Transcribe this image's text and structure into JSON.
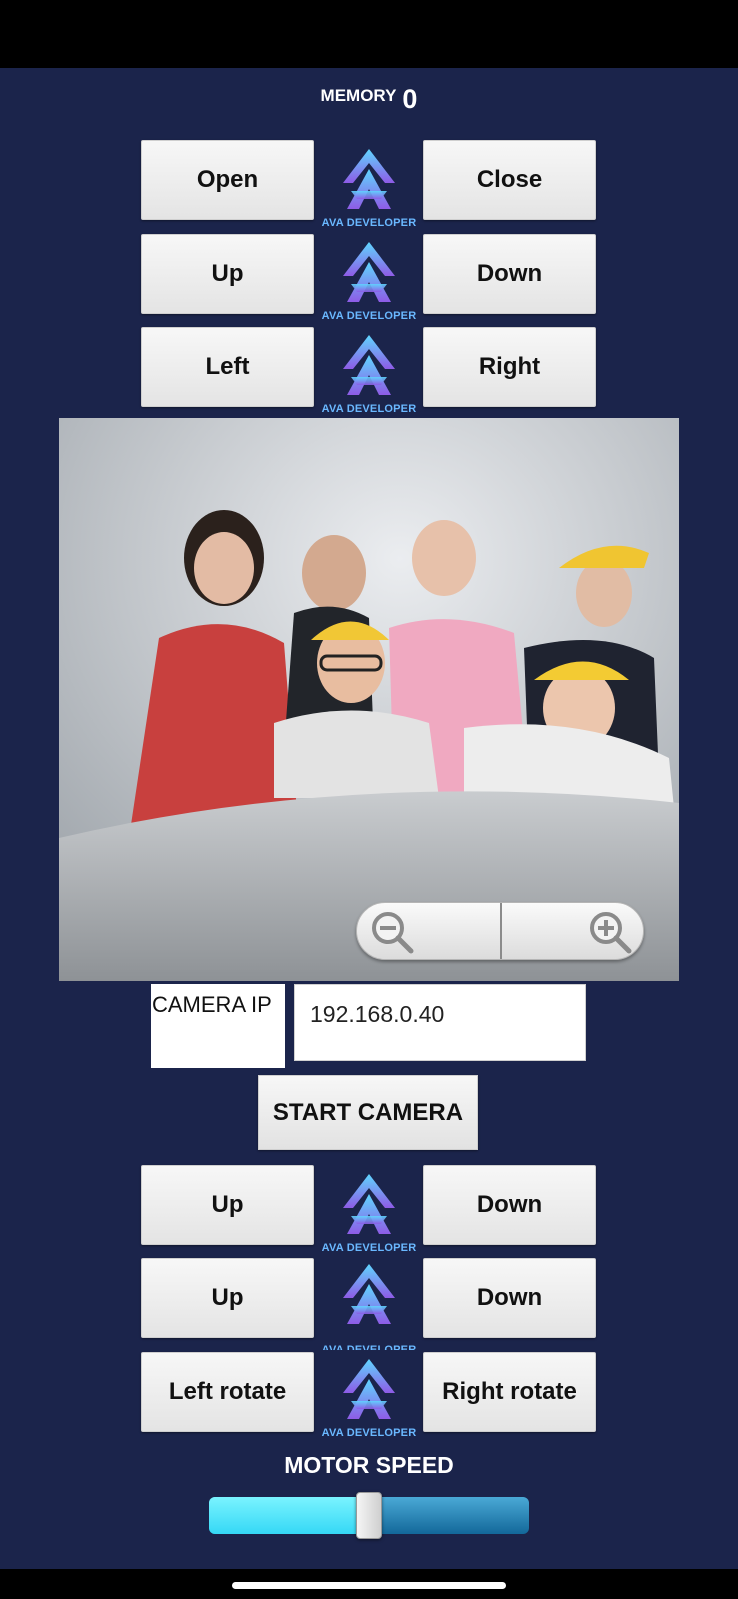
{
  "memory": {
    "label": "MEMORY",
    "value": "0"
  },
  "logo_text": "AVA DEVELOPER",
  "top_controls": [
    {
      "left": "Open",
      "right": "Close"
    },
    {
      "left": "Up",
      "right": "Down"
    },
    {
      "left": "Left",
      "right": "Right"
    }
  ],
  "camera": {
    "ip_label": "CAMERA IP",
    "ip_value": "192.168.0.40",
    "start_label": "START CAMERA"
  },
  "bottom_controls": [
    {
      "left": "Up",
      "right": "Down"
    },
    {
      "left": "Up",
      "right": "Down"
    },
    {
      "left": "Left rotate",
      "right": "Right rotate"
    }
  ],
  "motor_speed": {
    "label": "MOTOR SPEED",
    "value_fraction": 0.5
  },
  "colors": {
    "background": "#1b244b",
    "slider_fill": "#35d8f5",
    "logo_text": "#6ab8ff"
  }
}
